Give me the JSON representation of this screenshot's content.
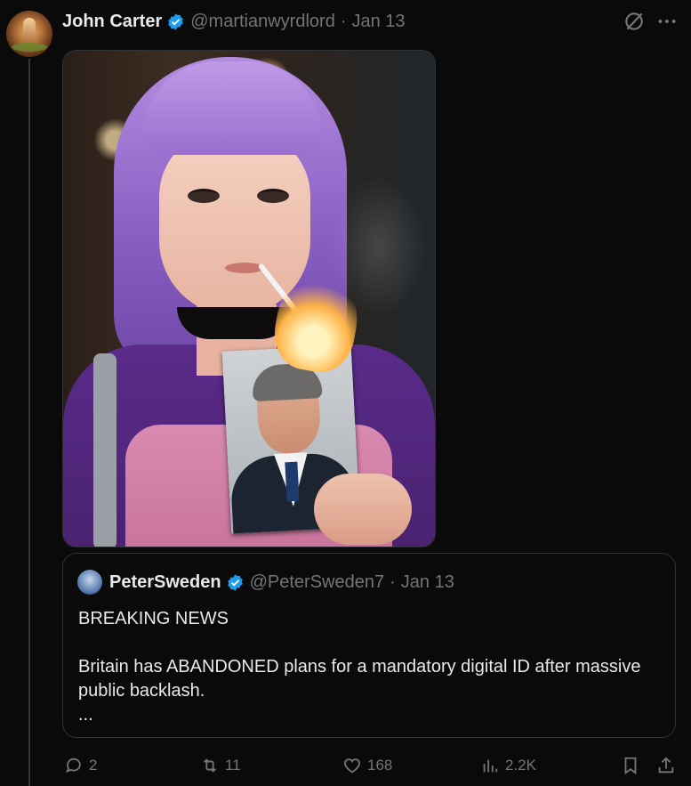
{
  "post": {
    "author_name": "John Carter",
    "handle": "@martianwyrdlord",
    "separator": "·",
    "date": "Jan 13",
    "avatar_icon": "avatar-icon",
    "verified_color": "#1d9bf0"
  },
  "quote": {
    "author_name": "PeterSweden",
    "handle": "@PeterSweden7",
    "separator": "·",
    "date": "Jan 13",
    "line1": "BREAKING NEWS",
    "line2": "Britain has ABANDONED plans for a mandatory digital ID after massive public backlash.",
    "ellipsis": "..."
  },
  "actions": {
    "replies": "2",
    "reposts": "11",
    "likes": "168",
    "views": "2.2K"
  }
}
